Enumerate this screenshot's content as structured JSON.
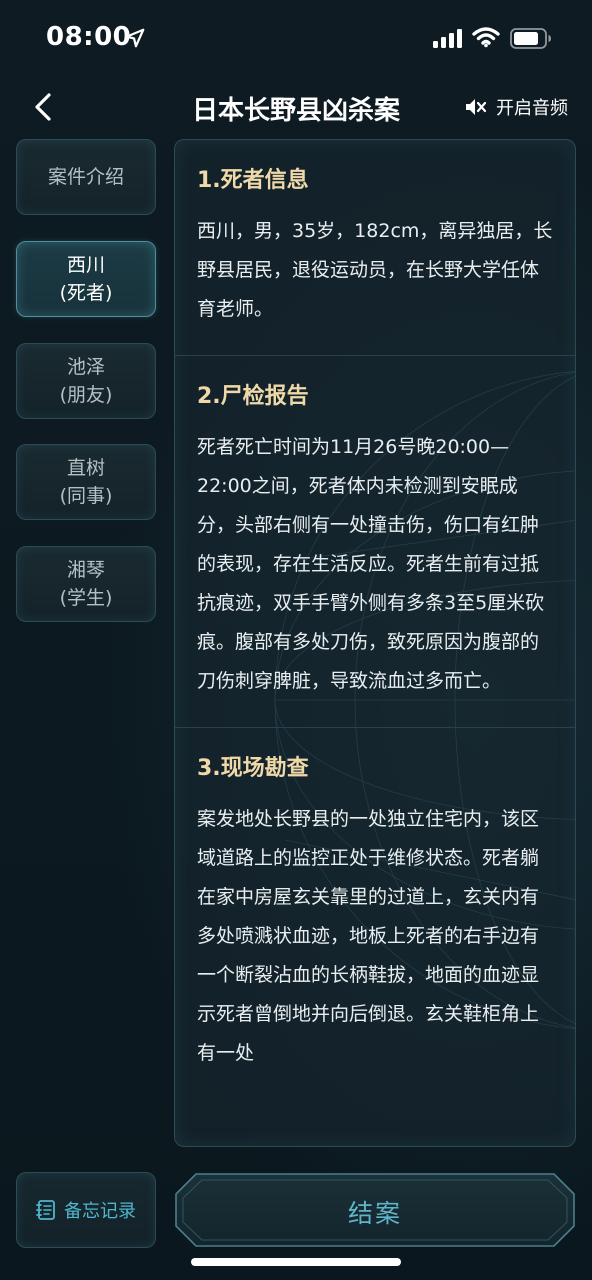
{
  "status_bar": {
    "time": "08:00",
    "icons": [
      "location-arrow-icon",
      "signal-icon",
      "wifi-icon",
      "battery-icon"
    ]
  },
  "header": {
    "title": "日本长野县凶杀案",
    "audio_label": "开启音频"
  },
  "sidebar": {
    "items": [
      {
        "lines": [
          "案件介绍"
        ],
        "active": false
      },
      {
        "lines": [
          "西川",
          "(死者)"
        ],
        "active": true
      },
      {
        "lines": [
          "池泽",
          "(朋友)"
        ],
        "active": false
      },
      {
        "lines": [
          "直树",
          "(同事)"
        ],
        "active": false
      },
      {
        "lines": [
          "湘琴",
          "(学生)"
        ],
        "active": false
      }
    ]
  },
  "sections": [
    {
      "title": "1.死者信息",
      "body": "西川，男，35岁，182cm，离异独居，长野县居民，退役运动员，在长野大学任体育老师。"
    },
    {
      "title": "2.尸检报告",
      "body": "死者死亡时间为11月26号晚20:00—22:00之间，死者体内未检测到安眠成分，头部右侧有一处撞击伤，伤口有红肿的表现，存在生活反应。死者生前有过抵抗痕迹，双手手臂外侧有多条3至5厘米砍痕。腹部有多处刀伤，致死原因为腹部的刀伤刺穿脾脏，导致流血过多而亡。"
    },
    {
      "title": "3.现场勘查",
      "body": "案发地处长野县的一处独立住宅内，该区域道路上的监控正处于维修状态。死者躺在家中房屋玄关靠里的过道上，玄关内有多处喷溅状血迹，地板上死者的右手边有一个断裂沾血的长柄鞋拔，地面的血迹显示死者曾倒地并向后倒退。玄关鞋柜角上有一处"
    }
  ],
  "footer": {
    "memo_label": "备忘记录",
    "close_case_label": "结案"
  },
  "colors": {
    "background": "#0d1a21",
    "accent_gold": "#f0d9a8",
    "accent_cyan": "#5fb4c8",
    "border": "#2b4b55"
  }
}
